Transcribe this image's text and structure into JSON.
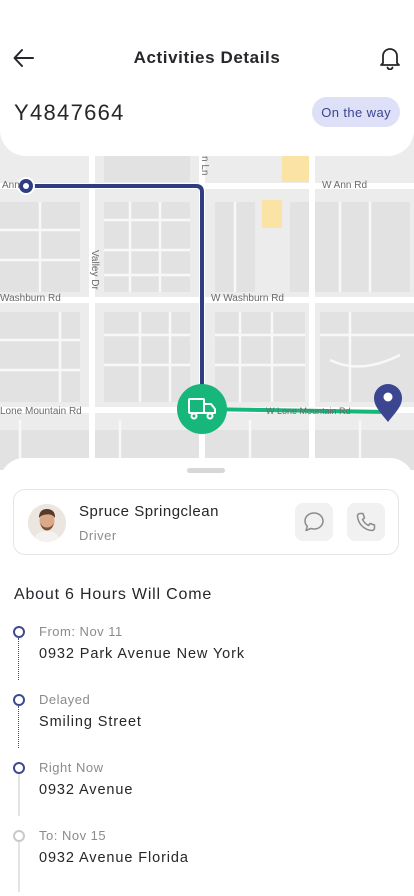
{
  "header": {
    "title": "Activities Details",
    "order_id": "Y4847664",
    "status": "On the way",
    "back_icon": "arrow-left-icon",
    "bell_icon": "bell-icon"
  },
  "map": {
    "streets": {
      "ann_left": "Ann",
      "w_ann_rd": "W Ann Rd",
      "valley_dr": "Valley Dr",
      "washburn_left": "Washburn Rd",
      "w_washburn_rd": "W Washburn Rd",
      "lone_mountain_left": "Lone Mountain Rd",
      "w_lone_mountain_rd": "W Lone Mountain Rd",
      "top_vertical": "n Ln"
    },
    "colors": {
      "route_done": "#2f3d82",
      "route_remaining": "#17b67a",
      "vehicle": "#17b67a",
      "destination_pin": "#3b4590"
    },
    "vehicle_icon": "truck-icon",
    "destination_icon": "map-pin-icon"
  },
  "driver": {
    "name": "Spruce Springclean",
    "role": "Driver",
    "chat_icon": "chat-bubble-icon",
    "call_icon": "phone-icon"
  },
  "eta": "About 6 Hours Will Come",
  "timeline": [
    {
      "label": "From: Nov 11",
      "value": "0932 Park Avenue New York",
      "state": "done"
    },
    {
      "label": "Delayed",
      "value": "Smiling Street",
      "state": "done"
    },
    {
      "label": "Right Now",
      "value": "0932 Avenue",
      "state": "current"
    },
    {
      "label": "To: Nov 15",
      "value": "0932 Avenue Florida",
      "state": "pending"
    }
  ]
}
